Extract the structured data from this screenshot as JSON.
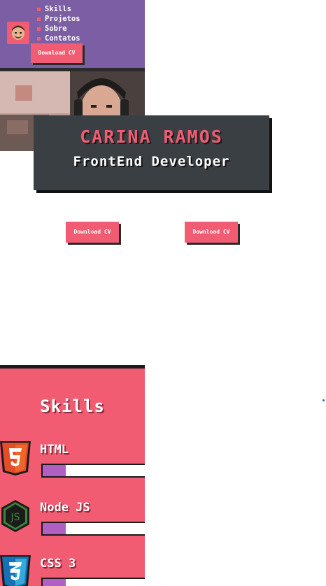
{
  "nav": {
    "items": [
      "Skills",
      "Projetos",
      "Sobre",
      "Contatos"
    ],
    "download_cv": "Download CV"
  },
  "hero": {
    "name": "CARINA RAMOS",
    "role": "FrontEnd Developer",
    "download_cv_1": "Download CV",
    "download_cv_2": "Download CV"
  },
  "skills": {
    "title": "Skills",
    "items": [
      {
        "name": "HTML",
        "icon": "html5-icon",
        "level": 0.2
      },
      {
        "name": "Node JS",
        "icon": "nodejs-icon",
        "level": 0.2
      },
      {
        "name": "CSS 3",
        "icon": "css3-icon",
        "level": 0.2
      }
    ]
  },
  "colors": {
    "accent": "#f25c73",
    "nav_bg": "#7b5ea3",
    "hero_bg": "#3a3f43",
    "bar_fill": "#b15fc2"
  }
}
